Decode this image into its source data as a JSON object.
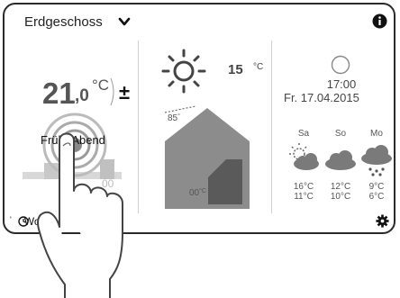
{
  "header": {
    "title": "Erdgeschoss",
    "dropdown_icon": "chevron-down-icon",
    "info_icon": "info-icon"
  },
  "room": {
    "temp_int": "21",
    "temp_dec": ",0",
    "unit": "°C",
    "adjust_symbol": "±",
    "mode_label": "Früh+Abend",
    "chart_fragment": "00",
    "footer_label": "Woc",
    "footer_icon": "clock-icon"
  },
  "house": {
    "outside_temp": "15",
    "outside_unit": "°C",
    "roof_temp": "85",
    "roof_unit": "°",
    "floor_temp": "00",
    "floor_unit": "°C",
    "weather_icon": "sun-icon"
  },
  "clock": {
    "time": "17:00",
    "date": "Fr. 17.04.2015",
    "icon": "clock-circle-icon"
  },
  "forecast": [
    {
      "day": "Sa",
      "icon": "sun-cloud-icon",
      "high": "16°C",
      "low": "11°C"
    },
    {
      "day": "So",
      "icon": "cloud-icon",
      "high": "12°C",
      "low": "10°C"
    },
    {
      "day": "Mo",
      "icon": "rain-cloud-icon",
      "high": "9°C",
      "low": "6°C"
    }
  ],
  "settings_icon": "gear-icon",
  "colors": {
    "frame": "#2a2a2a",
    "house_fill": "#8c8c8c",
    "window_fill": "#5a5a5a"
  }
}
